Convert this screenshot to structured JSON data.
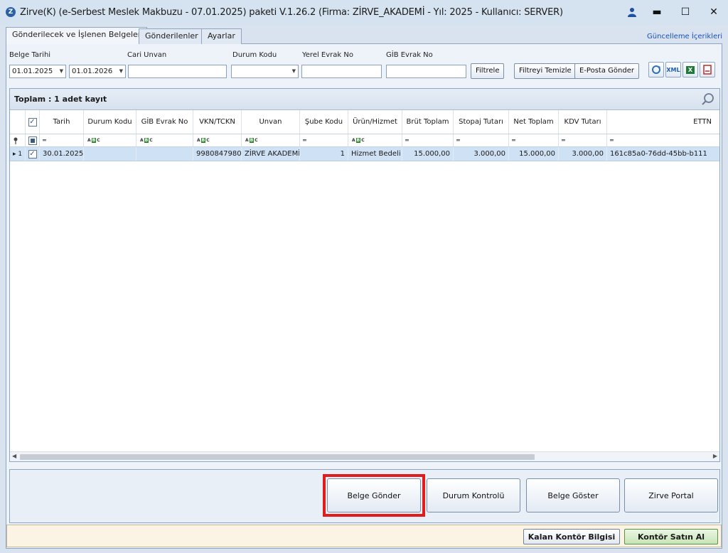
{
  "window": {
    "title": "Zirve(K)  (e-Serbest Meslek Makbuzu - 07.01.2025) paketi V.1.26.2 (Firma: ZİRVE_AKADEMİ - Yıl: 2025 - Kullanıcı: SERVER)",
    "logo_letter": "Z",
    "minimize": "▬",
    "maximize": "☐",
    "close": "✕"
  },
  "tabs": [
    {
      "label": "Gönderilecek ve İşlenen Belgeler"
    },
    {
      "label": "Gönderilenler"
    },
    {
      "label": "Ayarlar"
    }
  ],
  "guncelleme_link": "Güncelleme İçerikleri",
  "filters": {
    "belge_tarihi_label": "Belge Tarihi",
    "date_from": "01.01.2025",
    "date_to": "01.01.2026",
    "cari_unvan_label": "Cari Unvan",
    "durum_kodu_label": "Durum Kodu",
    "yerel_evrak_label": "Yerel Evrak No",
    "gib_evrak_label": "GİB Evrak No",
    "filtrele": "Filtrele",
    "filtreyi_temizle": "Filtreyi Temizle",
    "eposta_gonder": "E-Posta Gönder"
  },
  "toolbar_icons": {
    "xml": "XML",
    "excel": "X"
  },
  "grid": {
    "summary": "Toplam : 1 adet kayıt",
    "columns": [
      "Tarih",
      "Durum Kodu",
      "GİB Evrak No",
      "VKN/TCKN",
      "Unvan",
      "Şube Kodu",
      "Ürün/Hizmet",
      "Brüt Toplam",
      "Stopaj Tutarı",
      "Net Toplam",
      "KDV Tutarı",
      "ETTN"
    ],
    "filter_eq": "═",
    "row": {
      "index": "1",
      "tarih": "30.01.2025",
      "durum_kodu": "",
      "gib_evrak_no": "",
      "vkn": "9980847980",
      "unvan": "ZİRVE AKADEMİ",
      "sube_kodu": "1",
      "urun": "Hizmet Bedeli",
      "brut": "15.000,00",
      "stopaj": "3.000,00",
      "net": "15.000,00",
      "kdv": "3.000,00",
      "ettn": "161c85a0-76dd-45bb-b111"
    }
  },
  "actions": {
    "belge_gonder": "Belge Gönder",
    "durum_kontrolu": "Durum Kontrolü",
    "belge_goster": "Belge Göster",
    "zirve_portal": "Zirve Portal"
  },
  "status": {
    "kalan_kontor": "Kalan Kontör Bilgisi",
    "kontor_satin_al": "Kontör Satın Al"
  },
  "colors": {
    "highlight": "#e01c1c",
    "selected_row": "#cfe1f5"
  }
}
